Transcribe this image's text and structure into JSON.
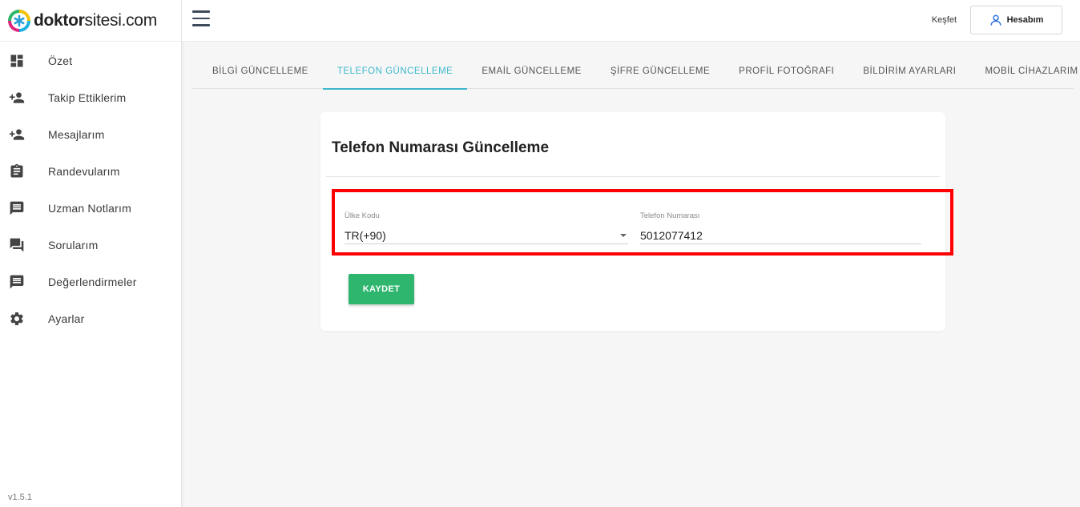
{
  "brand": {
    "bold": "doktor",
    "regular": "sitesi.com"
  },
  "sidebar": {
    "items": [
      {
        "label": "Özet",
        "icon": "dashboard-icon"
      },
      {
        "label": "Takip Ettiklerim",
        "icon": "person-add-icon"
      },
      {
        "label": "Mesajlarım",
        "icon": "person-add-icon"
      },
      {
        "label": "Randevularım",
        "icon": "clipboard-icon"
      },
      {
        "label": "Uzman Notlarım",
        "icon": "message-icon"
      },
      {
        "label": "Sorularım",
        "icon": "forum-icon"
      },
      {
        "label": "Değerlendirmeler",
        "icon": "message-icon"
      },
      {
        "label": "Ayarlar",
        "icon": "gear-icon"
      }
    ],
    "version": "v1.5.1"
  },
  "header": {
    "discover": "Keşfet",
    "account": "Hesabım"
  },
  "tabs": [
    {
      "label": "BİLGİ GÜNCELLEME",
      "active": false
    },
    {
      "label": "TELEFON GÜNCELLEME",
      "active": true
    },
    {
      "label": "EMAİL GÜNCELLEME",
      "active": false
    },
    {
      "label": "ŞİFRE GÜNCELLEME",
      "active": false
    },
    {
      "label": "PROFİL FOTOĞRAFI",
      "active": false
    },
    {
      "label": "BİLDİRİM AYARLARI",
      "active": false
    },
    {
      "label": "MOBİL CİHAZLARIM",
      "active": false
    }
  ],
  "form": {
    "title": "Telefon Numarası Güncelleme",
    "country_label": "Ülke Kodu",
    "country_value": "TR(+90)",
    "phone_label": "Telefon Numarası",
    "phone_value": "5012077412",
    "save_label": "KAYDET"
  },
  "colors": {
    "accent": "#3cb8cc",
    "save": "#2fb66e",
    "highlight": "#ff0000",
    "account_icon": "#2f6fe0"
  }
}
